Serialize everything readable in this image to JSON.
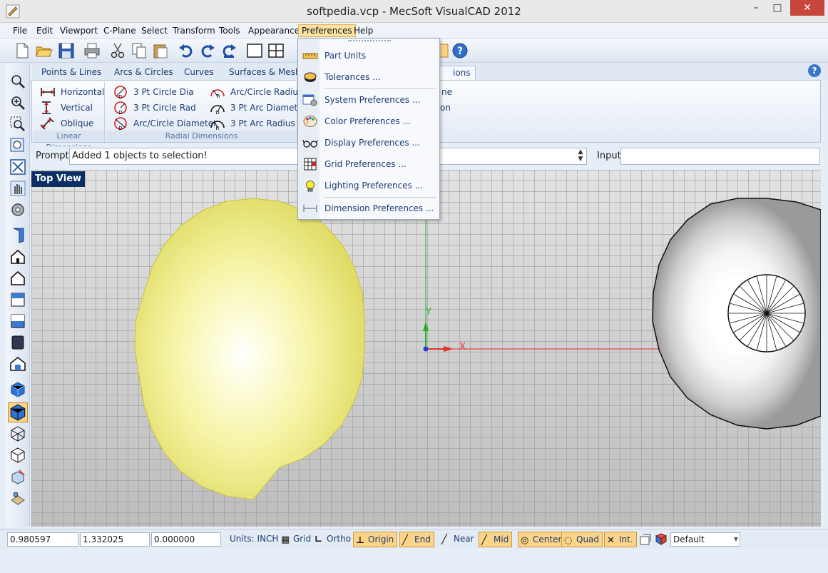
{
  "window": {
    "title": "softpedia.vcp - MecSoft VisualCAD 2012",
    "minimize": "–",
    "maximize": "□",
    "close": "✕"
  },
  "menubar": [
    "File",
    "Edit",
    "Viewport",
    "C-Plane",
    "Select",
    "Transform",
    "Tools",
    "Appearance",
    "Preferences",
    "Help"
  ],
  "ribbon": {
    "tabs": [
      "Points & Lines",
      "Arcs & Circles",
      "Curves",
      "Surfaces & Meshes",
      "ions"
    ],
    "linear_group": {
      "label": "Linear Dimensions",
      "items": [
        "Horizontal",
        "Vertical",
        "Oblique"
      ]
    },
    "radial_group": {
      "label": "Radial Dimensions",
      "items": [
        "3 Pt Circle Dia",
        "3 Pt Circle Rad",
        "Arc/Circle Diameter",
        "Arc/Circle Radius",
        "3 Pt Arc Diameter",
        "3 Pt Arc Radius"
      ]
    },
    "partial_items": [
      "ne",
      "on"
    ]
  },
  "prompt": {
    "label": "Prompt:",
    "message": "Added 1 objects to selection!",
    "input_label": "Input:",
    "input_value": ""
  },
  "viewport": {
    "title": "Top View",
    "axis_x": "X",
    "axis_y": "Y"
  },
  "preferences_menu": [
    {
      "label": "Part Units",
      "icon": "ruler-icon"
    },
    {
      "label": "Tolerances ...",
      "icon": "tolerance-icon"
    },
    {
      "label": "System Preferences ...",
      "icon": "system-prefs-icon"
    },
    {
      "label": "Color Preferences ...",
      "icon": "palette-icon"
    },
    {
      "label": "Display Preferences ...",
      "icon": "glasses-icon"
    },
    {
      "label": "Grid Preferences ...",
      "icon": "grid-icon"
    },
    {
      "label": "Lighting Preferences ...",
      "icon": "bulb-icon"
    },
    {
      "label": "Dimension Preferences ...",
      "icon": "dimension-icon"
    }
  ],
  "statusbar": {
    "x": "0.980597",
    "y": "1.332025",
    "z": "0.000000",
    "units": "Units: INCH",
    "grid": "Grid",
    "ortho": "Ortho",
    "origin": "Origin",
    "end": "End",
    "near": "Near",
    "mid": "Mid",
    "center": "Center",
    "quad": "Quad",
    "int": "Int.",
    "layer": "Default"
  },
  "colors": {
    "accent": "#0b2e63",
    "menu_highlight": "#fbe3a5",
    "sphere": "#f0ee8a",
    "x_axis": "#e0332b",
    "y_axis": "#22b322"
  }
}
